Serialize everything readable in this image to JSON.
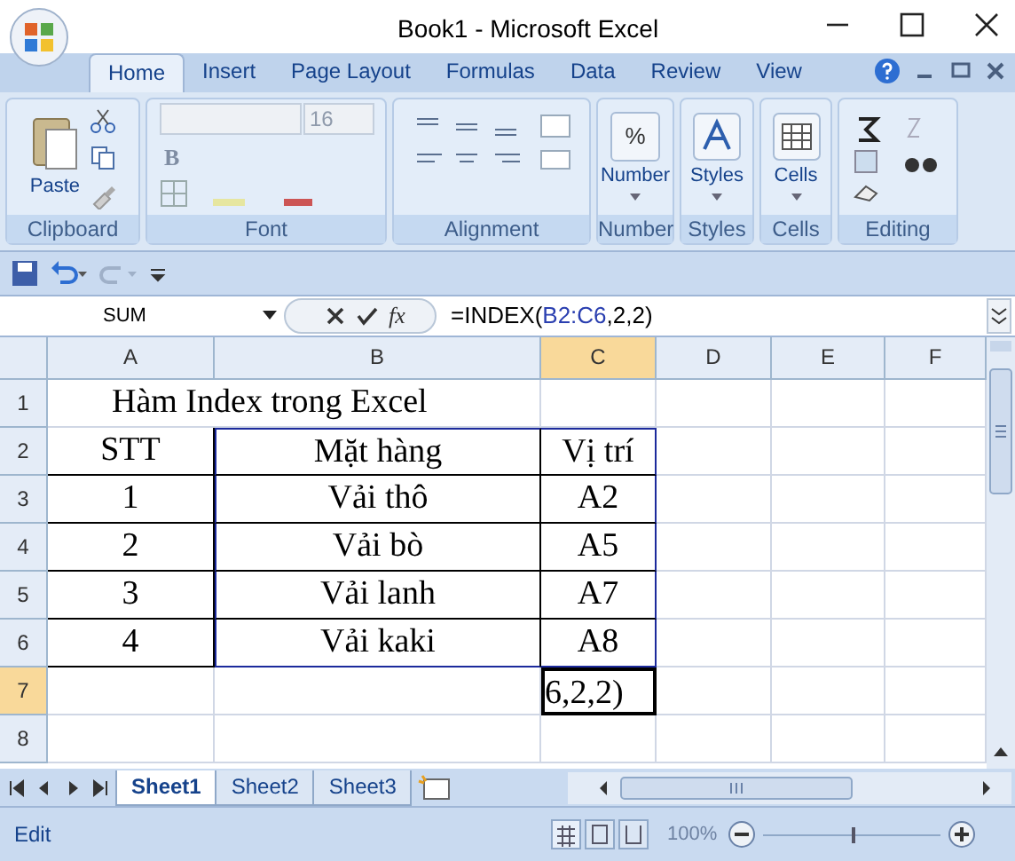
{
  "window": {
    "title": "Book1 - Microsoft Excel"
  },
  "tabs": [
    {
      "label": "Home",
      "selected": true
    },
    {
      "label": "Insert",
      "selected": false
    },
    {
      "label": "Page Layout",
      "selected": false
    },
    {
      "label": "Formulas",
      "selected": false
    },
    {
      "label": "Data",
      "selected": false
    },
    {
      "label": "Review",
      "selected": false
    },
    {
      "label": "View",
      "selected": false
    }
  ],
  "ribbon": {
    "clipboard": {
      "paste": "Paste",
      "label": "Clipboard"
    },
    "font": {
      "size": "16",
      "bold": "B",
      "label": "Font",
      "disabled": true
    },
    "alignment": {
      "label": "Alignment"
    },
    "number": {
      "icon": "%",
      "button": "Number",
      "label": "Number"
    },
    "styles": {
      "button": "Styles",
      "label": "Styles"
    },
    "cells": {
      "button": "Cells",
      "label": "Cells"
    },
    "editing": {
      "label": "Editing"
    }
  },
  "name_box": "SUM",
  "function_button": "fx",
  "formula": [
    {
      "text": "=INDEX(",
      "kind": "plain"
    },
    {
      "text": "B2:C6",
      "kind": "ref"
    },
    {
      "text": ",2,2)",
      "kind": "plain"
    }
  ],
  "columns": [
    {
      "label": "A",
      "selected": false
    },
    {
      "label": "B",
      "selected": false
    },
    {
      "label": "C",
      "selected": true
    },
    {
      "label": "D",
      "selected": false
    },
    {
      "label": "E",
      "selected": false
    },
    {
      "label": "F",
      "selected": false
    }
  ],
  "rows": [
    {
      "label": "1",
      "selected": false,
      "kind": "title",
      "cells": [
        {
          "kind": "text",
          "text": "Hàm Index trong Excel"
        }
      ]
    },
    {
      "label": "2",
      "selected": false,
      "kind": "table",
      "cells": [
        {
          "kind": "text",
          "text": "STT"
        },
        {
          "kind": "text",
          "text": "Mặt hàng"
        },
        {
          "kind": "text",
          "text": "Vị trí"
        }
      ]
    },
    {
      "label": "3",
      "selected": false,
      "kind": "table",
      "cells": [
        {
          "kind": "text",
          "text": "1"
        },
        {
          "kind": "text",
          "text": "Vải thô"
        },
        {
          "kind": "text",
          "text": "A2"
        }
      ]
    },
    {
      "label": "4",
      "selected": false,
      "kind": "table",
      "cells": [
        {
          "kind": "text",
          "text": "2"
        },
        {
          "kind": "text",
          "text": "Vải bò"
        },
        {
          "kind": "text",
          "text": "A5"
        }
      ]
    },
    {
      "label": "5",
      "selected": false,
      "kind": "table",
      "cells": [
        {
          "kind": "text",
          "text": "3"
        },
        {
          "kind": "text",
          "text": "Vải lanh"
        },
        {
          "kind": "text",
          "text": "A7"
        }
      ]
    },
    {
      "label": "6",
      "selected": false,
      "kind": "table",
      "cells": [
        {
          "kind": "text",
          "text": "4"
        },
        {
          "kind": "text",
          "text": "Vải kaki"
        },
        {
          "kind": "text",
          "text": "A8"
        }
      ]
    },
    {
      "label": "7",
      "selected": true,
      "kind": "plain",
      "cells": [
        {
          "kind": "empty"
        },
        {
          "kind": "empty"
        },
        {
          "kind": "active",
          "text": "6,2,2)"
        }
      ]
    },
    {
      "label": "8",
      "selected": false,
      "kind": "plain",
      "cells": []
    }
  ],
  "sheets": [
    {
      "label": "Sheet1",
      "selected": true
    },
    {
      "label": "Sheet2",
      "selected": false
    },
    {
      "label": "Sheet3",
      "selected": false
    }
  ],
  "status_bar": {
    "mode": "Edit",
    "zoom": "100%",
    "zoom_slider": {
      "level": 0.5
    }
  }
}
